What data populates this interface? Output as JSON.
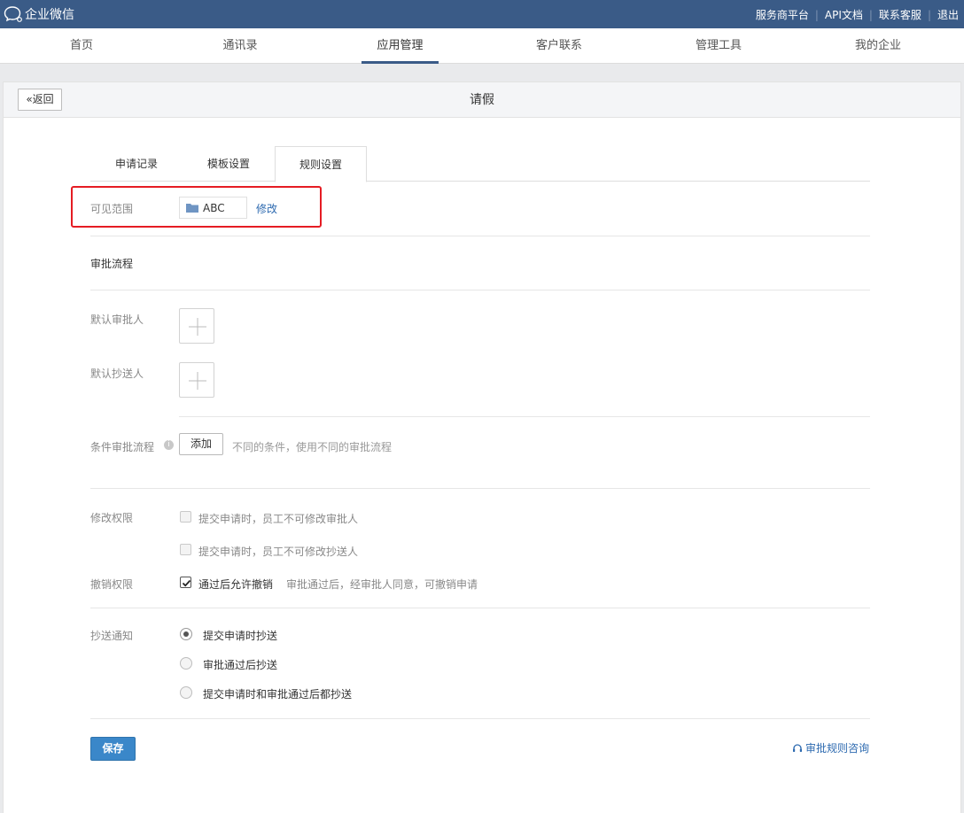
{
  "app": {
    "name": "企业微信"
  },
  "top_links": [
    "服务商平台",
    "API文档",
    "联系客服",
    "退出"
  ],
  "main_nav": [
    "首页",
    "通讯录",
    "应用管理",
    "客户联系",
    "管理工具",
    "我的企业"
  ],
  "main_nav_active": "应用管理",
  "panel": {
    "back_label": "返回",
    "title": "请假"
  },
  "tabs": [
    "申请记录",
    "模板设置",
    "规则设置"
  ],
  "tabs_active": "规则设置",
  "scope": {
    "label": "可见范围",
    "value": "ABC",
    "modify": "修改"
  },
  "approval": {
    "section_title": "审批流程",
    "default_approver": "默认审批人",
    "default_cc": "默认抄送人",
    "conditional_label": "条件审批流程",
    "add_button": "添加",
    "conditional_hint": "不同的条件，使用不同的审批流程"
  },
  "permissions": {
    "modify_label": "修改权限",
    "modify_opt1": "提交申请时，员工不可修改审批人",
    "modify_opt2": "提交申请时，员工不可修改抄送人",
    "revoke_label": "撤销权限",
    "revoke_opt": "通过后允许撤销",
    "revoke_hint": "审批通过后，经审批人同意，可撤销申请"
  },
  "cc_notify": {
    "label": "抄送通知",
    "options": [
      "提交申请时抄送",
      "审批通过后抄送",
      "提交申请时和审批通过后都抄送"
    ],
    "selected": 0
  },
  "footer": {
    "save": "保存",
    "consult": "审批规则咨询"
  },
  "colors": {
    "topbar": "#3a5b87",
    "link": "#2d6ab0",
    "save_button": "#3a87c9",
    "highlight": "#e51c23"
  }
}
